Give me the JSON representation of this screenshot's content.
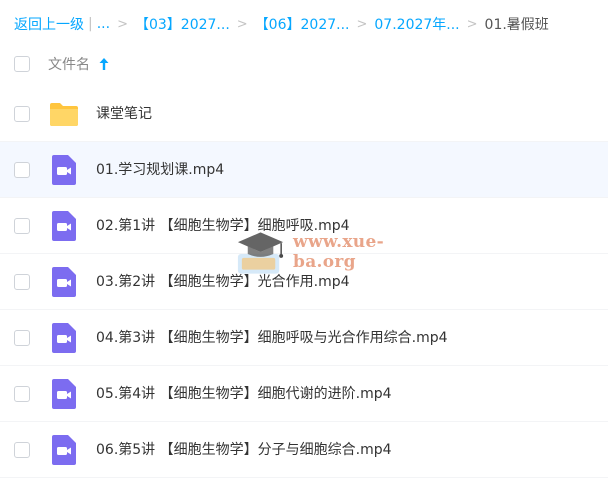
{
  "breadcrumb": {
    "back": "返回上一级",
    "ellipsis": "...",
    "items": [
      "【03】2027...",
      "【06】2027...",
      "07.2027年..."
    ],
    "current": "01.暑假班"
  },
  "header": {
    "column_name": "文件名"
  },
  "files": [
    {
      "name": "课堂笔记",
      "type": "folder"
    },
    {
      "name": "01.学习规划课.mp4",
      "type": "video"
    },
    {
      "name": "02.第1讲 【细胞生物学】细胞呼吸.mp4",
      "type": "video"
    },
    {
      "name": "03.第2讲 【细胞生物学】光合作用.mp4",
      "type": "video"
    },
    {
      "name": "04.第3讲 【细胞生物学】细胞呼吸与光合作用综合.mp4",
      "type": "video"
    },
    {
      "name": "05.第4讲 【细胞生物学】细胞代谢的进阶.mp4",
      "type": "video"
    },
    {
      "name": "06.第5讲 【细胞生物学】分子与细胞综合.mp4",
      "type": "video"
    }
  ],
  "watermark": {
    "text": "www.xue-ba.org"
  },
  "colors": {
    "accent": "#06a7ff",
    "folder": "#ffc53d",
    "video": "#7c6cf0",
    "highlight": "#f4f8ff"
  },
  "icons": {
    "folder": "folder-icon",
    "video": "video-file-icon",
    "sort": "sort-up-arrow-icon"
  }
}
